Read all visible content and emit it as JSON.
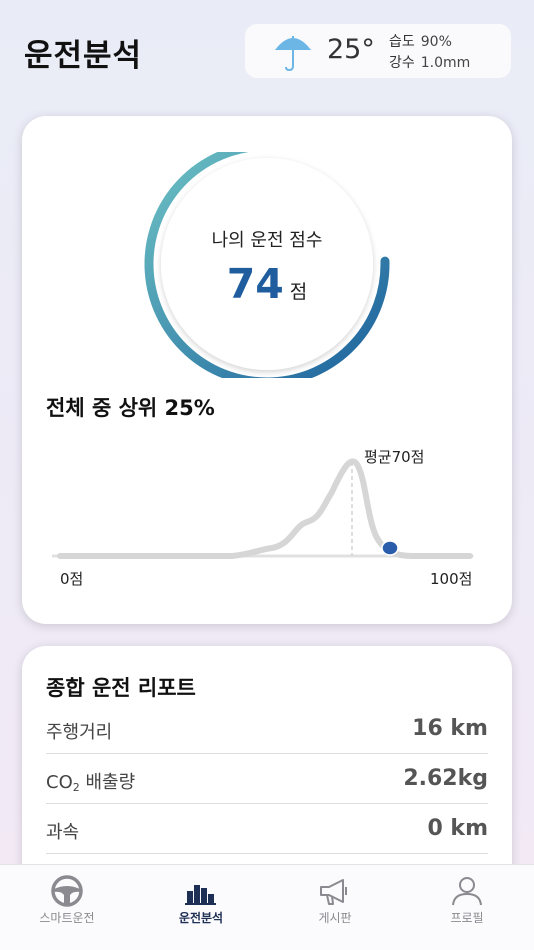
{
  "header": {
    "title": "운전분석",
    "weather": {
      "icon": "umbrella-icon",
      "temperature": "25°",
      "humidity_label": "습도",
      "humidity_value": "90%",
      "rain_label": "강수",
      "rain_value": "1.0mm"
    }
  },
  "score_card": {
    "gauge_label": "나의 운전 점수",
    "score": "74",
    "score_unit": "점",
    "score_value": 74,
    "score_max": 100,
    "rank_text": "전체 중 상위 25%",
    "avg_label": "평균70점",
    "axis_min": "0점",
    "axis_max": "100점",
    "colors": {
      "gauge_start": "#6ec3c4",
      "gauge_end": "#1a5f9c",
      "marker": "#2b5cab",
      "curve": "#d6d6d6"
    }
  },
  "report": {
    "title": "종합 운전 리포트",
    "rows": [
      {
        "label": "주행거리",
        "value": "16 km"
      },
      {
        "label_main": "CO",
        "label_sub": "2",
        "label_rest": " 배출량",
        "value": "2.62kg"
      },
      {
        "label": "과속",
        "value": "0 km"
      }
    ]
  },
  "tabbar": {
    "tabs": [
      {
        "label": "스마트운전",
        "icon": "steering-wheel-icon",
        "active": false
      },
      {
        "label": "운전분석",
        "icon": "bar-chart-icon",
        "active": true
      },
      {
        "label": "게시판",
        "icon": "megaphone-icon",
        "active": false
      },
      {
        "label": "프로필",
        "icon": "person-icon",
        "active": false
      }
    ]
  }
}
